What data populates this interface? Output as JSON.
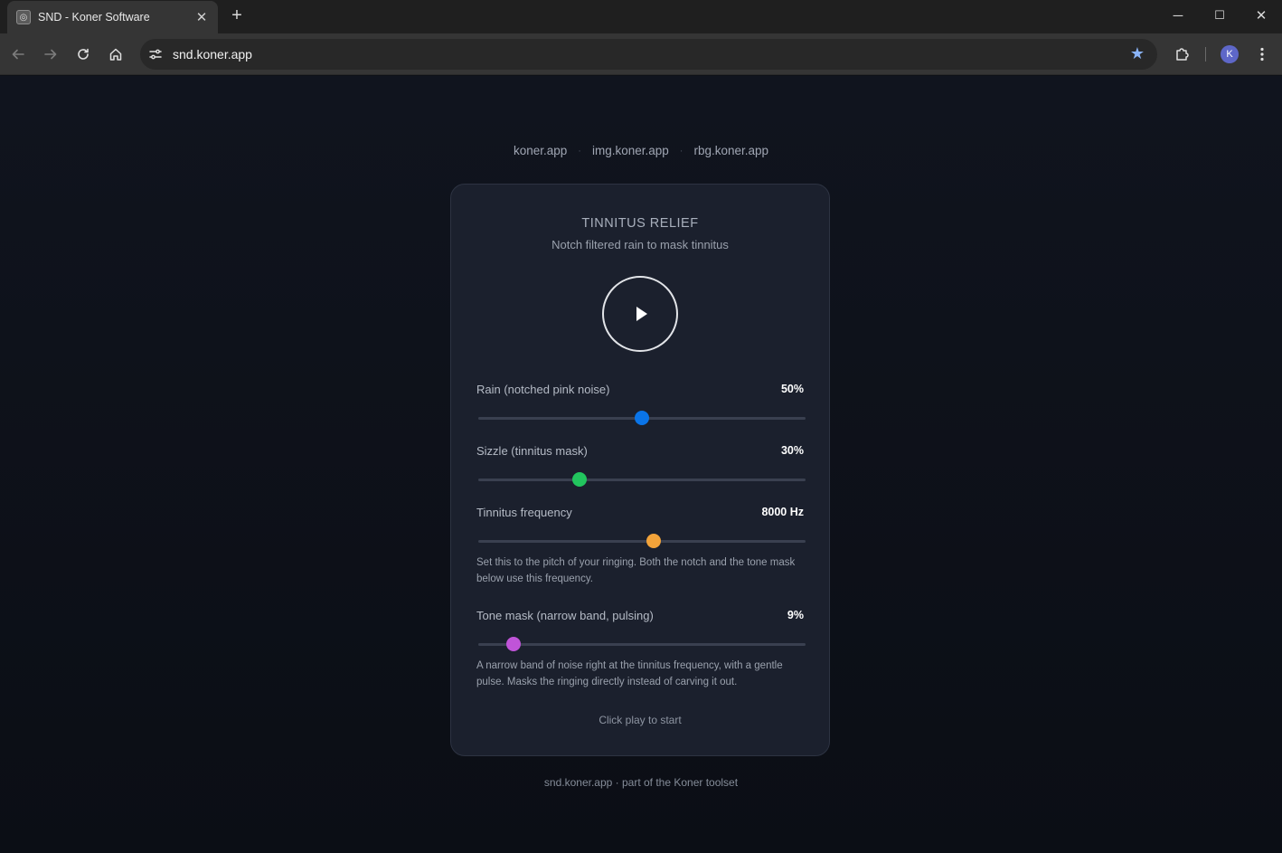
{
  "browser": {
    "tab_title": "SND - Koner Software",
    "tab_close": "✕",
    "new_tab": "+",
    "url": "snd.koner.app",
    "profile_initial": "K",
    "window_controls": {
      "minimize": "─",
      "maximize": "☐",
      "close": "✕"
    }
  },
  "topnav": {
    "links": [
      "koner.app",
      "img.koner.app",
      "rbg.koner.app"
    ],
    "separator": "·"
  },
  "card": {
    "title": "TINNITUS RELIEF",
    "subtitle": "Notch filtered rain to mask tinnitus",
    "controls": [
      {
        "label": "Rain (notched pink noise)",
        "value": "50%",
        "level": 0.5,
        "color": "#0a74e8"
      },
      {
        "label": "Sizzle (tinnitus mask)",
        "value": "30%",
        "level": 0.31,
        "color": "#22c55e"
      },
      {
        "label": "Tinnitus frequency",
        "value": "8000 Hz",
        "level": 0.535,
        "color": "#f2a33a",
        "help": "Set this to the pitch of your ringing. Both the notch and the tone mask below use this frequency."
      },
      {
        "label": "Tone mask (narrow band, pulsing)",
        "value": "9%",
        "level": 0.108,
        "color": "#c054d8",
        "help": "A narrow band of noise right at the tinnitus frequency, with a gentle pulse. Masks the ringing directly instead of carving it out."
      }
    ],
    "status": "Click play to start"
  },
  "footer": "snd.koner.app · part of the Koner toolset"
}
